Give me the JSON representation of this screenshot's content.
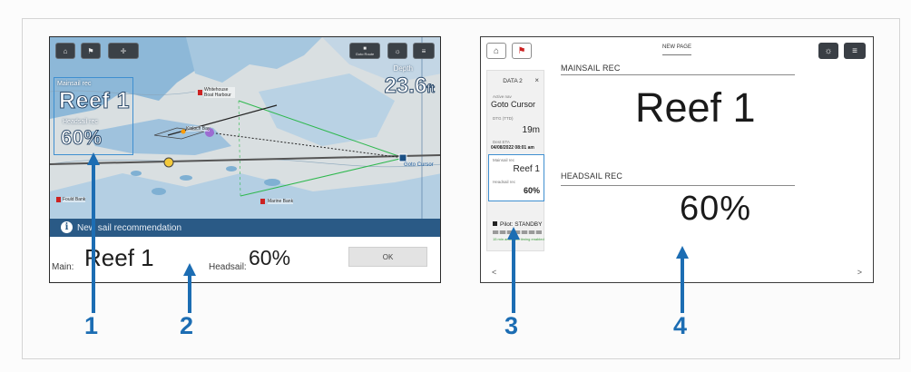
{
  "left_screen": {
    "toolbar": {
      "home_icon": "home-icon",
      "waypoint_icon": "waypoint-icon",
      "ship_icon": "ship-icon",
      "small_button_label": "Goto Route",
      "settings_icon": "sun-icon",
      "menu_icon": "menu-icon"
    },
    "overlay": {
      "main_label": "Mainsail rec",
      "main_value": "Reef 1",
      "head_label": "Headsail rec",
      "head_value": "60%"
    },
    "depth": {
      "label": "Depth",
      "value": "23.6",
      "unit": "ft"
    },
    "chart_tags": [
      "Whitehouse Boat Harbour",
      "Goto Cursor",
      "Fould Bank",
      "Marine Bank",
      "Kinloch Bay"
    ],
    "notification": {
      "title": "New sail recommendation",
      "main_label": "Main:",
      "main_value": "Reef 1",
      "headsail_label": "Headsail:",
      "headsail_value": "60%",
      "ok_label": "OK"
    }
  },
  "right_screen": {
    "page_title": "NEW PAGE",
    "sidebar": {
      "title": "DATA 2",
      "close": "×",
      "active_nav_label": "Active nav",
      "active_nav_value": "Goto Cursor",
      "dtg_label": "DTG (TTD)",
      "dtg_value": "19m",
      "eta_label": "Dest ETA",
      "eta_value": "04/08/2022 08:01 am",
      "mainsail_label": "Mainsail rec",
      "mainsail_value": "Reef 1",
      "headsail_label": "Headsail rec",
      "headsail_value": "60%",
      "pilot_label": "Pilot: STANDBY",
      "pilot_sub": "15 min auto-pilot timing enabled"
    },
    "mainsail_heading": "MAINSAIL REC",
    "mainsail_value": "Reef 1",
    "headsail_heading": "HEADSAIL REC",
    "headsail_value": "60%",
    "prev_arrow": "<",
    "next_arrow": ">"
  },
  "callouts": [
    "1",
    "2",
    "3",
    "4"
  ],
  "colors": {
    "callout_blue": "#1c6db3",
    "notification_bar": "#2a5a86",
    "highlight_border": "#3f8fd0"
  }
}
